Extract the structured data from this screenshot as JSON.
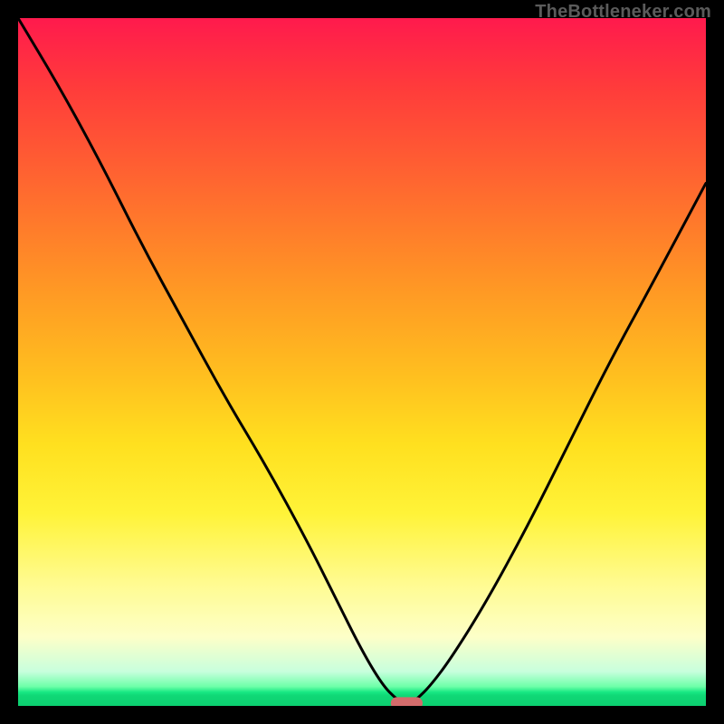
{
  "watermark": "TheBottleneker.com",
  "chart_data": {
    "type": "line",
    "title": "",
    "xlabel": "",
    "ylabel": "",
    "xlim": [
      0,
      100
    ],
    "ylim": [
      0,
      100
    ],
    "x": [
      0,
      6,
      12,
      18,
      24,
      30,
      36,
      42,
      46,
      50,
      53,
      55,
      56.5,
      58,
      60,
      63,
      68,
      74,
      80,
      86,
      92,
      100
    ],
    "values": [
      100,
      90,
      79,
      67,
      56,
      45,
      35,
      24,
      16,
      8,
      3,
      1,
      0,
      1,
      3,
      7,
      15,
      26,
      38,
      50,
      61,
      76
    ],
    "marker": {
      "x": 56.5,
      "y": 0,
      "width_pct": 4.5,
      "height_pct": 1.6,
      "color": "#d36b6b"
    },
    "gradient_stops": [
      {
        "pos": 0.0,
        "color": "#ff1a4d"
      },
      {
        "pos": 0.5,
        "color": "#ffbf1f"
      },
      {
        "pos": 0.8,
        "color": "#fffb8f"
      },
      {
        "pos": 0.97,
        "color": "#6dffa8"
      },
      {
        "pos": 1.0,
        "color": "#0ccf70"
      }
    ]
  }
}
